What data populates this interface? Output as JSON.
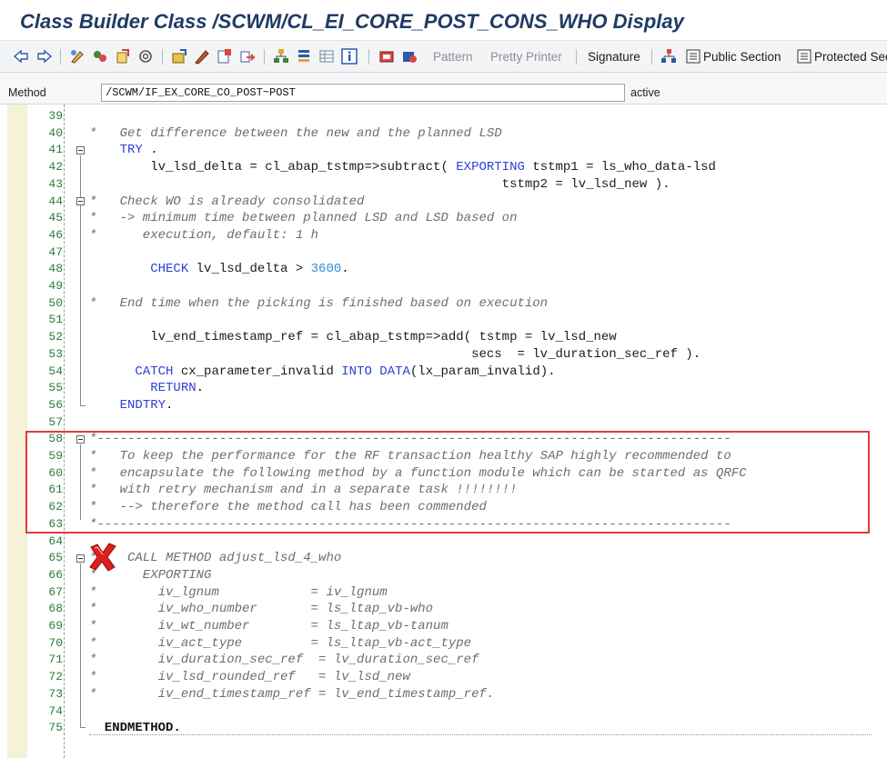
{
  "window": {
    "title": "Class Builder Class /SCWM/CL_EI_CORE_POST_CONS_WHO Display"
  },
  "toolbar": {
    "icons": [
      "back-arrow-icon",
      "forward-arrow-icon",
      "other-object-icon",
      "display-change-icon",
      "activate-icon",
      "check-icon",
      "where-used-icon",
      "edit-object-icon",
      "navigate-icon",
      "object-list-icon",
      "hierarchy-icon",
      "info-icon",
      "insert-icon",
      "delete-icon"
    ],
    "pattern_label": "Pattern",
    "pretty_printer_label": "Pretty Printer",
    "signature_label": "Signature",
    "public_section_label": "Public Section",
    "protected_section_label": "Protected Sec"
  },
  "method": {
    "label": "Method",
    "value": "/SCWM/IF_EX_CORE_CO_POST~POST",
    "status": "active"
  },
  "editor": {
    "lines": [
      {
        "n": "39",
        "text": ""
      },
      {
        "n": "40",
        "text": "*   Get difference between the new and the planned LSD"
      },
      {
        "n": "41",
        "text": "    TRY ."
      },
      {
        "n": "42",
        "text": "        lv_lsd_delta = cl_abap_tstmp=>subtract( EXPORTING tstmp1 = ls_who_data-lsd"
      },
      {
        "n": "43",
        "text": "                                                      tstmp2 = lv_lsd_new )."
      },
      {
        "n": "44",
        "text": "*   Check WO is already consolidated"
      },
      {
        "n": "45",
        "text": "*   -> minimum time between planned LSD and LSD based on"
      },
      {
        "n": "46",
        "text": "*      execution, default: 1 h"
      },
      {
        "n": "47",
        "text": ""
      },
      {
        "n": "48",
        "text": "        CHECK lv_lsd_delta > 3600."
      },
      {
        "n": "49",
        "text": ""
      },
      {
        "n": "50",
        "text": "*   End time when the picking is finished based on execution"
      },
      {
        "n": "51",
        "text": ""
      },
      {
        "n": "52",
        "text": "        lv_end_timestamp_ref = cl_abap_tstmp=>add( tstmp = lv_lsd_new"
      },
      {
        "n": "53",
        "text": "                                                  secs  = lv_duration_sec_ref )."
      },
      {
        "n": "54",
        "text": "      CATCH cx_parameter_invalid INTO DATA(lx_param_invalid)."
      },
      {
        "n": "55",
        "text": "        RETURN."
      },
      {
        "n": "56",
        "text": "    ENDTRY."
      },
      {
        "n": "57",
        "text": ""
      },
      {
        "n": "58",
        "text": "*-----------------------------------------------------------------------------------"
      },
      {
        "n": "59",
        "text": "*   To keep the performance for the RF transaction healthy SAP highly recommended to"
      },
      {
        "n": "60",
        "text": "*   encapsulate the following method by a function module which can be started as QRFC"
      },
      {
        "n": "61",
        "text": "*   with retry mechanism and in a separate task !!!!!!!!"
      },
      {
        "n": "62",
        "text": "*   --> therefore the method call has been commended"
      },
      {
        "n": "63",
        "text": "*-----------------------------------------------------------------------------------"
      },
      {
        "n": "64",
        "text": ""
      },
      {
        "n": "65",
        "text": "*    CALL METHOD adjust_lsd_4_who"
      },
      {
        "n": "66",
        "text": "*      EXPORTING"
      },
      {
        "n": "67",
        "text": "*        iv_lgnum            = iv_lgnum"
      },
      {
        "n": "68",
        "text": "*        iv_who_number       = ls_ltap_vb-who"
      },
      {
        "n": "69",
        "text": "*        iv_wt_number        = ls_ltap_vb-tanum"
      },
      {
        "n": "70",
        "text": "*        iv_act_type         = ls_ltap_vb-act_type"
      },
      {
        "n": "71",
        "text": "*        iv_duration_sec_ref  = lv_duration_sec_ref"
      },
      {
        "n": "72",
        "text": "*        iv_lsd_rounded_ref   = lv_lsd_new"
      },
      {
        "n": "73",
        "text": "*        iv_end_timestamp_ref = lv_end_timestamp_ref."
      },
      {
        "n": "74",
        "text": ""
      },
      {
        "n": "75",
        "text": "  ENDMETHOD."
      }
    ]
  },
  "colors": {
    "title": "#1f3b63",
    "keyword": "#2b3fd6",
    "comment": "#6e6e6e",
    "number": "#2f8fdc",
    "line_number": "#2c7a3e",
    "highlight_box": "#e23b3b"
  }
}
